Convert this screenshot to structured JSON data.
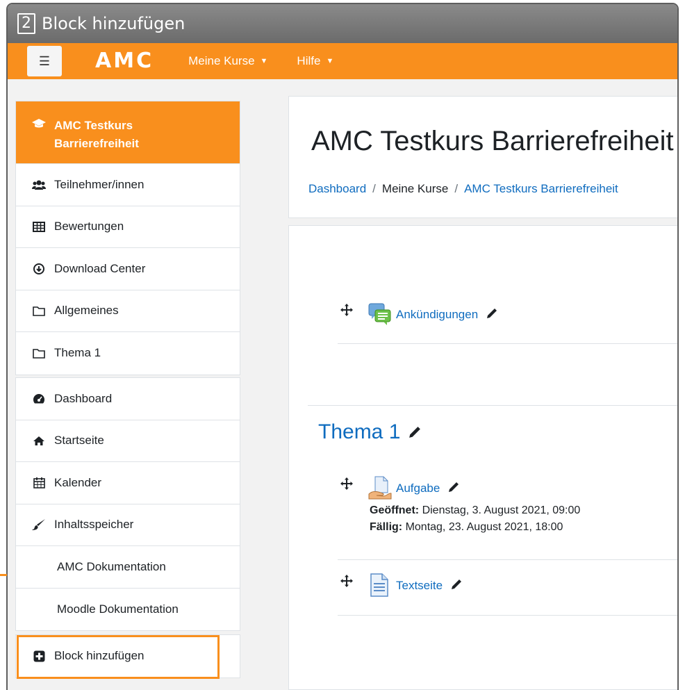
{
  "callout": {
    "step": "2",
    "title": "Block hinzufügen"
  },
  "navbar": {
    "brand": "AMC",
    "menus": [
      {
        "label": "Meine Kurse"
      },
      {
        "label": "Hilfe"
      }
    ]
  },
  "drawer": {
    "course": {
      "title_line1": "AMC Testkurs",
      "title_line2": "Barrierefreiheit",
      "items": [
        {
          "label": "Teilnehmer/innen",
          "icon": "users-icon"
        },
        {
          "label": "Bewertungen",
          "icon": "grades-table-icon"
        },
        {
          "label": "Download Center",
          "icon": "download-icon"
        },
        {
          "label": "Allgemeines",
          "icon": "folder-icon"
        },
        {
          "label": "Thema 1",
          "icon": "folder-icon"
        }
      ]
    },
    "site": {
      "items": [
        {
          "label": "Dashboard",
          "icon": "dashboard-icon"
        },
        {
          "label": "Startseite",
          "icon": "home-icon"
        },
        {
          "label": "Kalender",
          "icon": "calendar-icon"
        },
        {
          "label": "Inhaltsspeicher",
          "icon": "paintbrush-icon"
        },
        {
          "label": "AMC Dokumentation"
        },
        {
          "label": "Moodle Dokumentation"
        }
      ]
    },
    "add_block": {
      "label": "Block hinzufügen",
      "icon": "plus-square-icon"
    }
  },
  "page": {
    "title": "AMC Testkurs Barrierefreiheit",
    "breadcrumb": [
      "Dashboard",
      "Meine Kurse",
      "AMC Testkurs Barrierefreiheit"
    ]
  },
  "course_content": {
    "general": {
      "activities": [
        {
          "name": "Ankündigungen",
          "icon": "forum-icon"
        }
      ]
    },
    "section1": {
      "title": "Thema 1",
      "assignment": {
        "name": "Aufgabe",
        "opened_label": "Geöffnet:",
        "opened_value": "Dienstag, 3. August 2021, 09:00",
        "due_label": "Fällig:",
        "due_value": "Montag, 23. August 2021, 18:00"
      },
      "page": {
        "name": "Textseite"
      }
    }
  },
  "colors": {
    "accent": "#f98f1d",
    "link": "#0f6cbf",
    "frame": "#6b6b6b"
  }
}
